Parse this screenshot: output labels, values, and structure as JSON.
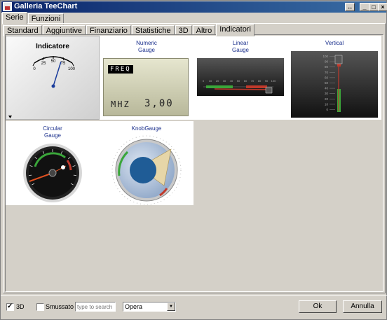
{
  "window": {
    "title": "Galleria TeeChart"
  },
  "main_tabs": [
    {
      "label": "Serie",
      "active": true
    },
    {
      "label": "Funzioni",
      "active": false
    }
  ],
  "sub_tabs": [
    {
      "label": "Standard"
    },
    {
      "label": "Aggiuntive"
    },
    {
      "label": "Finanziario"
    },
    {
      "label": "Statistiche"
    },
    {
      "label": "3D"
    },
    {
      "label": "Altro"
    },
    {
      "label": "Indicatori",
      "active": true
    }
  ],
  "gallery": [
    {
      "title": [
        "Indicatore"
      ],
      "selected": true,
      "scale": [
        "0",
        "25",
        "50",
        "75",
        "100"
      ]
    },
    {
      "title": [
        "Numeric",
        "Gauge"
      ],
      "display": {
        "top": "FREQ",
        "unit": "MHZ",
        "value": "3,00"
      }
    },
    {
      "title": [
        "Linear",
        "Gauge"
      ],
      "scale": [
        "0",
        "10",
        "20",
        "30",
        "40",
        "50",
        "60",
        "70",
        "80",
        "90",
        "100"
      ]
    },
    {
      "title": [
        "Vertical"
      ],
      "scale": [
        "100",
        "90",
        "80",
        "70",
        "60",
        "50",
        "40",
        "30",
        "20",
        "10",
        "0"
      ]
    },
    {
      "title": [
        "Circular",
        "Gauge"
      ]
    },
    {
      "title": [
        "KnobGauge"
      ]
    }
  ],
  "bottom": {
    "chk_3d": {
      "label": "3D",
      "checked": true
    },
    "chk_smooth": {
      "label": "Smussato",
      "checked": false
    },
    "search": {
      "placeholder": "type to search"
    },
    "theme_select": {
      "value": "Opera"
    },
    "ok_label": "Ok",
    "cancel_label": "Annulla"
  },
  "colors": {
    "title_bar": "#0a246a",
    "gauge_green": "#3aa63a",
    "gauge_red": "#c0392b",
    "label_blue": "#1a2f8c"
  },
  "icons": [
    "restore-icon",
    "minimize-icon",
    "maximize-icon",
    "close-icon",
    "dropdown-arrow-icon"
  ]
}
